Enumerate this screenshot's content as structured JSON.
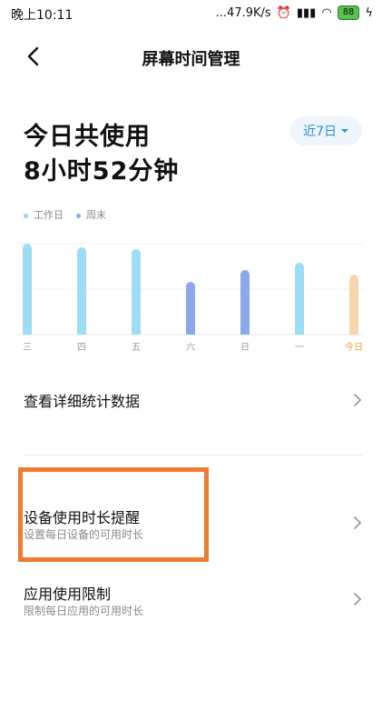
{
  "status_bar": {
    "time": "晚上10:11",
    "network_speed": "...47.9K/s",
    "battery": "88"
  },
  "header": {
    "back_icon": "chevron-left-icon",
    "title": "屏幕时间管理"
  },
  "summary": {
    "label": "今日共使用",
    "value": "8小时52分钟",
    "range_label": "近7日"
  },
  "legend": [
    {
      "label": "工作日",
      "color": "#8ed6f5"
    },
    {
      "label": "周末",
      "color": "#8aa8ea"
    }
  ],
  "chart_data": {
    "type": "bar",
    "categories": [
      "三",
      "四",
      "五",
      "六",
      "日",
      "一",
      "今日"
    ],
    "values": [
      10.0,
      9.6,
      9.4,
      5.8,
      7.1,
      7.9,
      6.6
    ],
    "ylim": [
      0,
      10
    ],
    "grid": true,
    "legend_position": "top-left",
    "colors": [
      "#9ddcf5",
      "#9ddcf5",
      "#9ddcf5",
      "#8aa8ea",
      "#8aa8ea",
      "#9ddcf5",
      "#f8d6ad"
    ],
    "highlight_label_color": "#f2a23a"
  },
  "menu": {
    "stats": {
      "label": "查看详细统计数据"
    },
    "device_reminder": {
      "label": "设备使用时长提醒",
      "sub": "设置每日设备的可用时长"
    },
    "app_limit": {
      "label": "应用使用限制",
      "sub": "限制每日应用的可用时长"
    }
  },
  "annotation_color": "#ee7b2f"
}
